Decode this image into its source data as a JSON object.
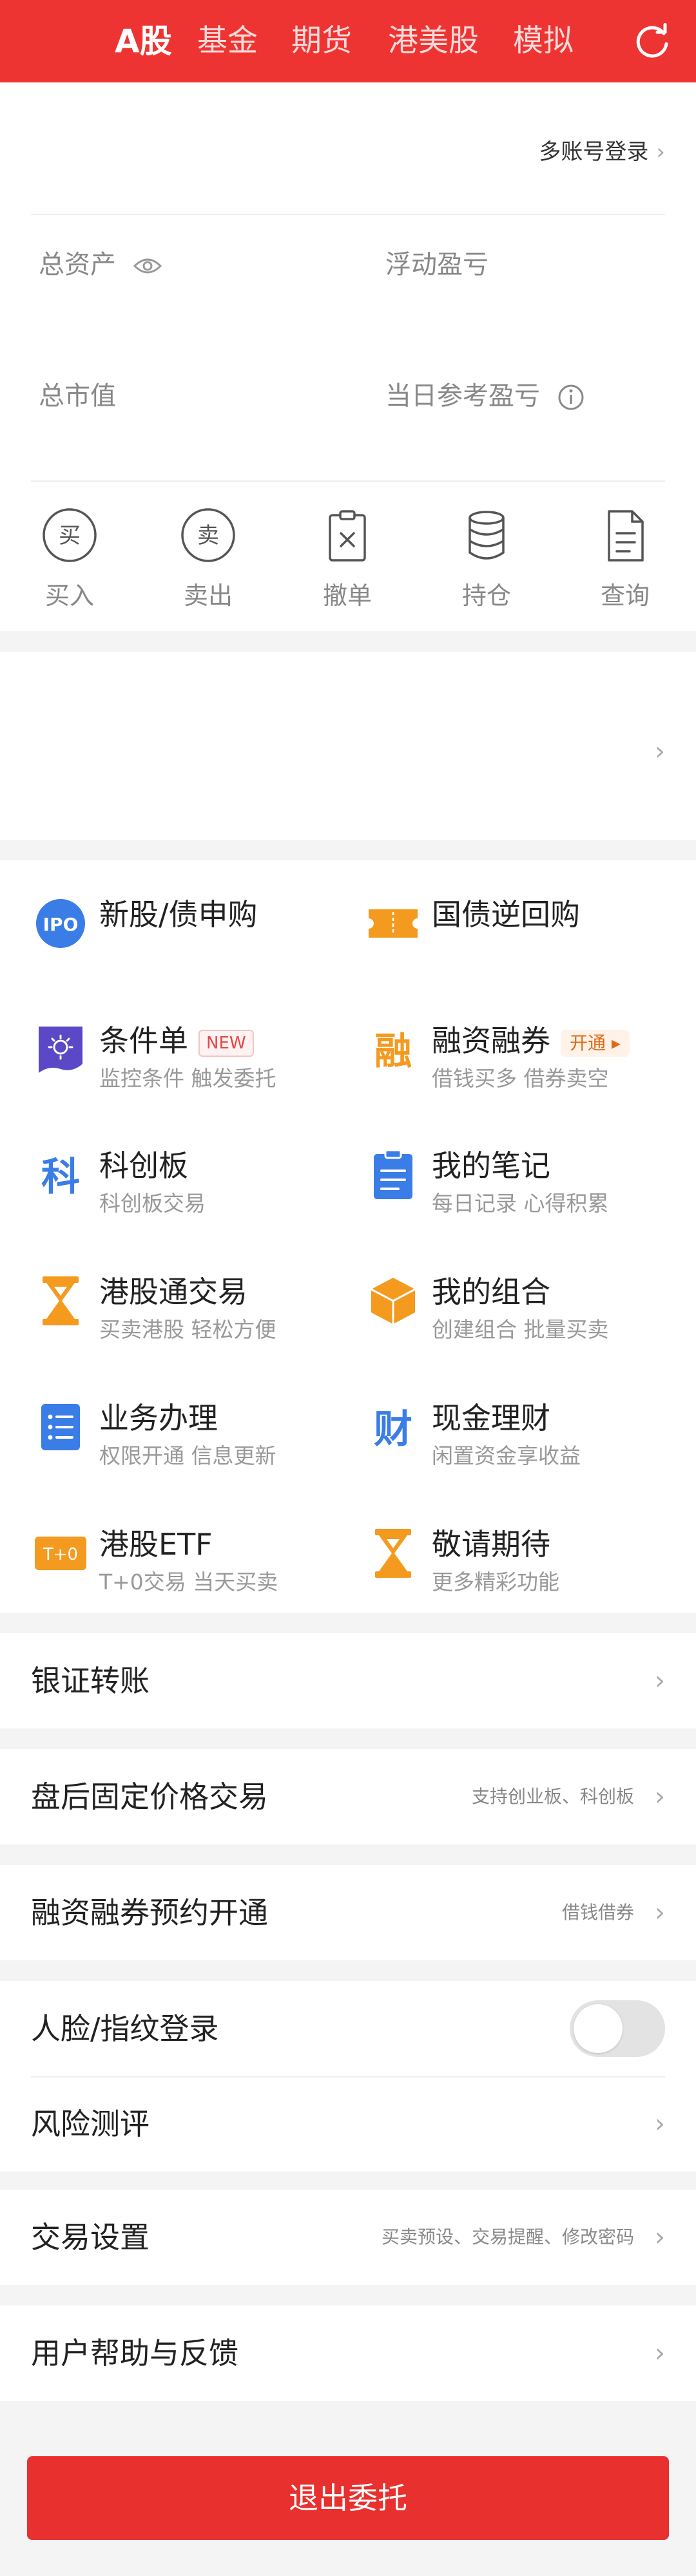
{
  "header": {
    "tabs": [
      {
        "label": "A股",
        "active": true
      },
      {
        "label": "基金"
      },
      {
        "label": "期货"
      },
      {
        "label": "港美股"
      },
      {
        "label": "模拟"
      }
    ],
    "refresh_icon": "refresh-icon"
  },
  "account": {
    "multi_login": "多账号登录",
    "total_assets": "总资产",
    "floating_pnl": "浮动盈亏",
    "market_value": "总市值",
    "daily_ref_pnl": "当日参考盈亏",
    "eye_icon": "eye-icon",
    "info_icon": "info-icon"
  },
  "quick_actions": [
    {
      "label": "买入",
      "icon": "buy-icon"
    },
    {
      "label": "卖出",
      "icon": "sell-icon"
    },
    {
      "label": "撤单",
      "icon": "cancel-order-icon"
    },
    {
      "label": "持仓",
      "icon": "holdings-icon"
    },
    {
      "label": "查询",
      "icon": "query-icon"
    }
  ],
  "features": [
    {
      "title": "新股/债申购",
      "subtitle": "",
      "icon": "ipo-icon"
    },
    {
      "title": "国债逆回购",
      "subtitle": "",
      "icon": "ticket-icon"
    },
    {
      "title": "条件单",
      "subtitle": "监控条件 触发委托",
      "icon": "condition-order-icon",
      "badge": "NEW"
    },
    {
      "title": "融资融券",
      "subtitle": "借钱买多 借券卖空",
      "icon": "margin-icon",
      "badge": "开通"
    },
    {
      "title": "科创板",
      "subtitle": "科创板交易",
      "icon": "star-market-icon"
    },
    {
      "title": "我的笔记",
      "subtitle": "每日记录 心得积累",
      "icon": "notes-icon"
    },
    {
      "title": "港股通交易",
      "subtitle": "买卖港股 轻松方便",
      "icon": "hourglass-icon"
    },
    {
      "title": "我的组合",
      "subtitle": "创建组合 批量买卖",
      "icon": "portfolio-icon"
    },
    {
      "title": "业务办理",
      "subtitle": "权限开通 信息更新",
      "icon": "service-list-icon"
    },
    {
      "title": "现金理财",
      "subtitle": "闲置资金享收益",
      "icon": "wealth-icon"
    },
    {
      "title": "港股ETF",
      "subtitle": "T+0交易 当天买卖",
      "icon": "t0-icon"
    },
    {
      "title": "敬请期待",
      "subtitle": "更多精彩功能",
      "icon": "hourglass-icon"
    }
  ],
  "menu": {
    "bank_transfer": "银证转账",
    "after_hours": "盘后固定价格交易",
    "after_hours_hint": "支持创业板、科创板",
    "margin_reserve": "融资融券预约开通",
    "margin_reserve_hint": "借钱借券",
    "face_login": "人脸/指纹登录",
    "face_login_on": false,
    "risk_eval": "风险测评",
    "trade_settings": "交易设置",
    "trade_settings_hint": "买卖预设、交易提醒、修改密码",
    "help": "用户帮助与反馈"
  },
  "logout": "退出委托",
  "colors": {
    "brand_red": "#ee3432",
    "accent_blue": "#3a7de6",
    "accent_orange": "#f39a1f",
    "accent_purple": "#5b48c7"
  }
}
